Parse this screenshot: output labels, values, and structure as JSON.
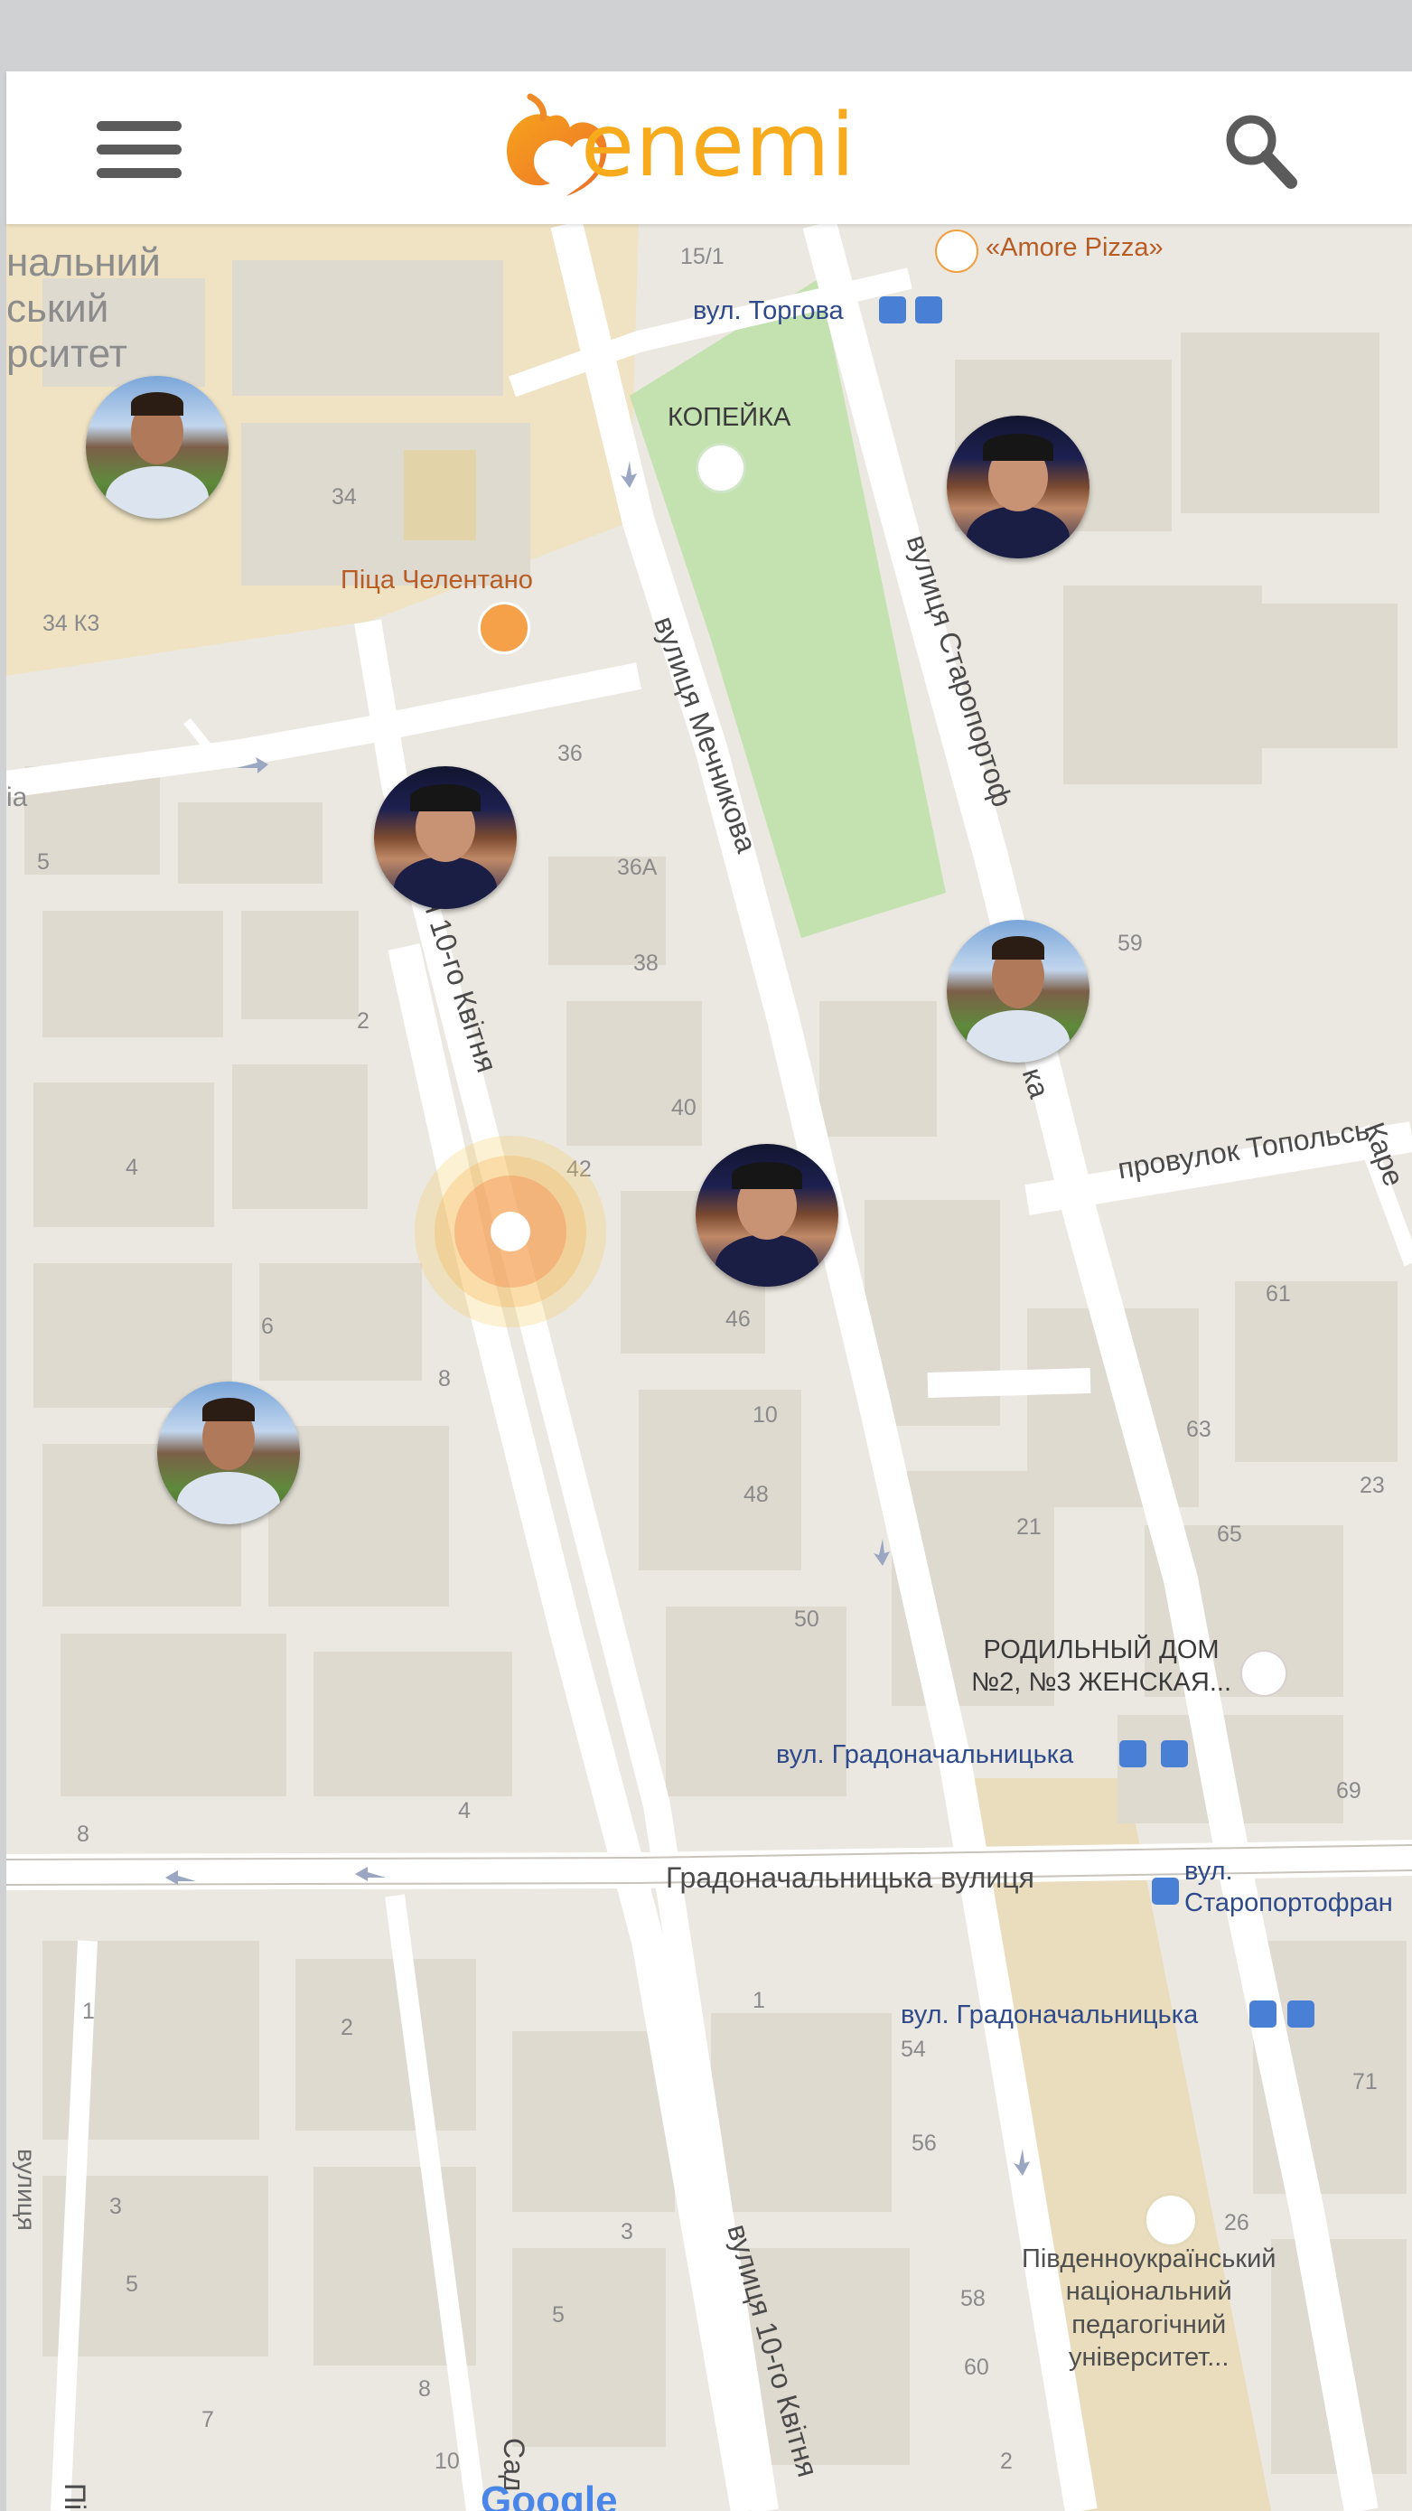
{
  "app": {
    "name": "enemi",
    "menu_icon": "hamburger-icon",
    "search_icon": "search-icon",
    "accent_color": "#f6aa1c",
    "logo_color": "#f08a26"
  },
  "map": {
    "attribution": "Google",
    "labels": {
      "university_top_left": [
        "нальний",
        "ський",
        "рситет"
      ],
      "n15_1": "15/1",
      "amore_pizza": "«Amore Pizza»",
      "torgova_stop": "вул. Торгова",
      "kopeika": "КОПЕЙКА",
      "n34": "34",
      "pitsa": "Піца Челентано",
      "n34k3": "34 К3",
      "ia": "іа",
      "n36": "36",
      "n36a": "36А",
      "n5": "5",
      "n38": "38",
      "n2": "2",
      "n59": "59",
      "n40": "40",
      "n4": "4",
      "n42": "42",
      "toplska": "провулок Топольсь",
      "kare": "Каре",
      "n61": "61",
      "n6": "6",
      "n46": "46",
      "n8": "8",
      "n10": "10",
      "n63": "63",
      "n48": "48",
      "n23": "23",
      "n21": "21",
      "n65": "65",
      "n50": "50",
      "rodylnyi": [
        "РОДИЛЬНЫЙ ДОМ",
        "№2, №3 ЖЕНСКАЯ..."
      ],
      "gradon_stop_1": "вул. Градоначальницька",
      "n69": "69",
      "n8b": "8",
      "n4b": "4",
      "gradon_street": "Градоначальницька вулиця",
      "staroport_stop": [
        "вул.",
        "Старопортофран"
      ],
      "n1": "1",
      "n2b": "2",
      "n1b": "1",
      "gradon_stop_2": "вул. Градоначальницька",
      "n54": "54",
      "n71": "71",
      "n56": "56",
      "n3": "3",
      "n3b": "3",
      "n26": "26",
      "university_bottom": [
        "Південноукраїнський",
        "національний",
        "педагогічний",
        "університет..."
      ],
      "n5b": "5",
      "n5c": "5",
      "n58": "58",
      "n8c": "8",
      "n60": "60",
      "n7": "7",
      "n10b": "10",
      "n2c": "2",
      "mechnikova": "вулиця Мечникова",
      "staroportofr_street": "вулиця Старопортоф",
      "ka": "ка",
      "kvitnia": "я 10-го Квітня",
      "kvitnia2": "вулиця 10-го Квітня",
      "vulytsia_left": "вулиця",
      "sad": "Сад",
      "pi": "Пі"
    }
  },
  "user_pins": [
    {
      "label": "user-pin-man-park",
      "style": "a"
    },
    {
      "label": "user-pin-man-cap",
      "style": "b"
    },
    {
      "label": "user-pin-man-cap",
      "style": "b"
    },
    {
      "label": "user-pin-man-park",
      "style": "a"
    },
    {
      "label": "user-pin-man-cap",
      "style": "b"
    },
    {
      "label": "user-pin-man-park",
      "style": "a"
    }
  ]
}
